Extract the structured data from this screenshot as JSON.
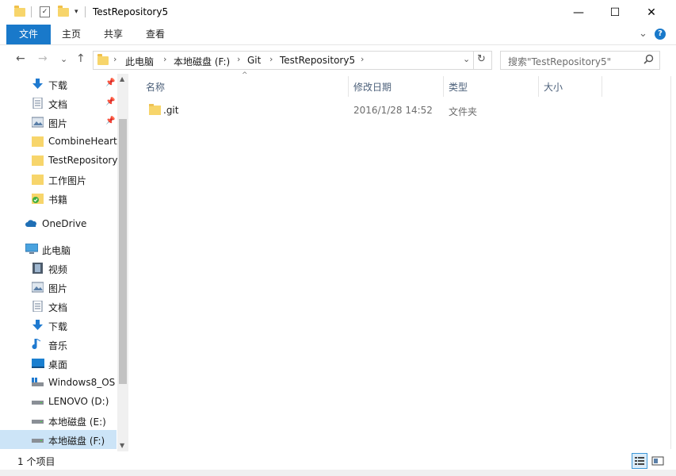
{
  "window": {
    "title": "TestRepository5",
    "minimize_glyph": "—",
    "maximize_glyph": "☐",
    "close_glyph": "✕"
  },
  "ribbon": {
    "tabs": [
      {
        "label": "文件"
      },
      {
        "label": "主页"
      },
      {
        "label": "共享"
      },
      {
        "label": "查看"
      }
    ],
    "expand_glyph": "⌄",
    "help_glyph": "?"
  },
  "nav": {
    "back_glyph": "←",
    "forward_glyph": "→",
    "recent_glyph": "⌄",
    "up_glyph": "↑",
    "breadcrumb": [
      "此电脑",
      "本地磁盘 (F:)",
      "Git",
      "TestRepository5"
    ],
    "refresh_glyph": "↻"
  },
  "search": {
    "placeholder": "搜索\"TestRepository5\"",
    "icon": "search-icon"
  },
  "sidebar": {
    "items": [
      {
        "label": "下载",
        "icon": "download-icon",
        "pinned": true
      },
      {
        "label": "文档",
        "icon": "document-icon",
        "pinned": true
      },
      {
        "label": "图片",
        "icon": "picture-icon",
        "pinned": true
      },
      {
        "label": "CombineHeart",
        "icon": "folder-icon",
        "pinned": false
      },
      {
        "label": "TestRepository",
        "icon": "folder-icon",
        "pinned": false
      },
      {
        "label": "工作图片",
        "icon": "folder-icon",
        "pinned": false
      },
      {
        "label": "书籍",
        "icon": "book-folder-icon",
        "pinned": false
      },
      {
        "label": "OneDrive",
        "icon": "cloud-icon",
        "pinned": false
      },
      {
        "label": "此电脑",
        "icon": "computer-icon",
        "pinned": false
      },
      {
        "label": "视频",
        "icon": "video-icon",
        "pinned": false
      },
      {
        "label": "图片",
        "icon": "picture-icon",
        "pinned": false
      },
      {
        "label": "文档",
        "icon": "document-icon",
        "pinned": false
      },
      {
        "label": "下载",
        "icon": "download-icon",
        "pinned": false
      },
      {
        "label": "音乐",
        "icon": "music-icon",
        "pinned": false
      },
      {
        "label": "桌面",
        "icon": "desktop-icon",
        "pinned": false
      },
      {
        "label": "Windows8_OS",
        "icon": "drive-os-icon",
        "pinned": false
      },
      {
        "label": "LENOVO (D:)",
        "icon": "drive-icon",
        "pinned": false
      },
      {
        "label": "本地磁盘 (E:)",
        "icon": "drive-icon",
        "pinned": false
      },
      {
        "label": "本地磁盘 (F:)",
        "icon": "drive-icon",
        "pinned": false,
        "selected": true
      }
    ]
  },
  "table": {
    "columns": [
      "名称",
      "修改日期",
      "类型",
      "大小"
    ],
    "rows": [
      {
        "name": ".git",
        "modified": "2016/1/28 14:52",
        "type": "文件夹",
        "size": ""
      }
    ]
  },
  "status": {
    "count_text": "1 个项目"
  },
  "colors": {
    "accent": "#1979ca",
    "selection": "#cce4f7",
    "folder": "#f7d56b",
    "header_text": "#4c607a"
  }
}
